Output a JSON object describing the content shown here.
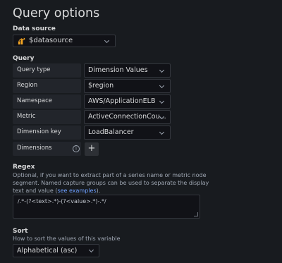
{
  "header": {
    "title": "Query options"
  },
  "datasource": {
    "label": "Data source",
    "value": "$datasource",
    "icon": "cloudwatch-logo-icon"
  },
  "query": {
    "label": "Query",
    "rows": [
      {
        "label": "Query type",
        "value": "Dimension Values"
      },
      {
        "label": "Region",
        "value": "$region"
      },
      {
        "label": "Namespace",
        "value": "AWS/ApplicationELB"
      },
      {
        "label": "Metric",
        "value": "ActiveConnectionCou..."
      },
      {
        "label": "Dimension key",
        "value": "LoadBalancer"
      }
    ],
    "dimensions": {
      "label": "Dimensions",
      "add_symbol": "+"
    }
  },
  "regex": {
    "label": "Regex",
    "description_before": "Optional, if you want to extract part of a series name or metric node segment. Named capture groups can be used to separate the display text and value (",
    "description_link": "see examples",
    "description_after": ").",
    "value": "/.*-(?<text>.*)-(?<value>.*)-.*/"
  },
  "sort": {
    "label": "Sort",
    "description": "How to sort the values of this variable",
    "value": "Alphabetical (asc)"
  },
  "colors": {
    "background": "#181b1f",
    "input_background": "#111217",
    "label_background": "#22252b",
    "border": "#34373e",
    "link": "#6e9fff",
    "logo_orange": "#f5a623"
  }
}
